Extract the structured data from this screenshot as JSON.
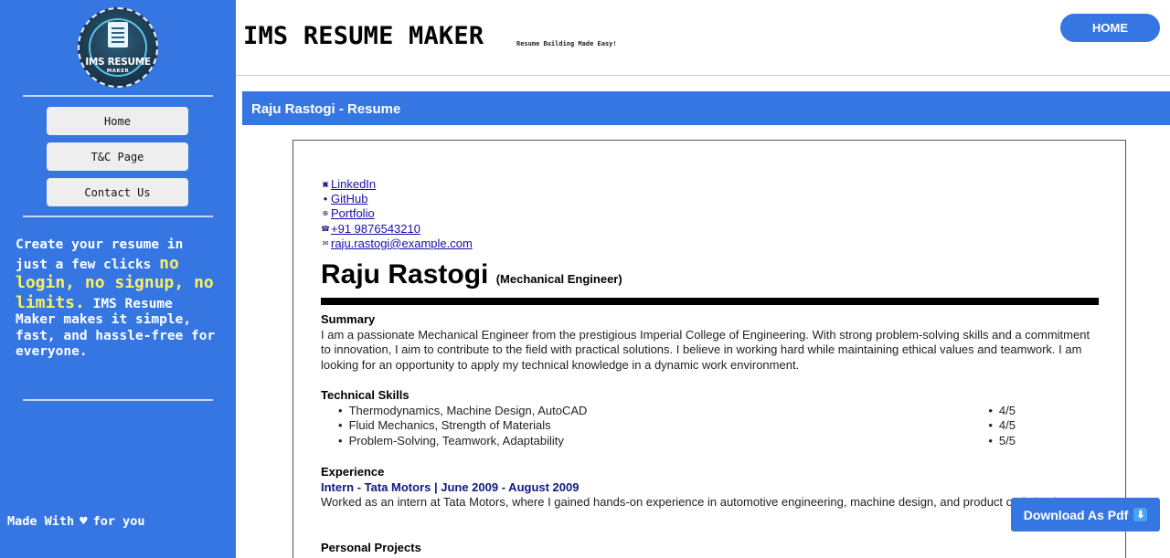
{
  "sidebar": {
    "logo": {
      "line1": "IMS RESUME",
      "line2": "MAKER"
    },
    "nav": [
      {
        "label": "Home"
      },
      {
        "label": "T&C Page"
      },
      {
        "label": "Contact Us"
      }
    ],
    "tagline": {
      "part1": "Create your resume in just a few clicks ",
      "highlight": "no login, no signup, no limits.",
      "part2": " IMS Resume Maker makes it simple, fast, and hassle-free for everyone."
    },
    "footer": {
      "before": "Made With",
      "icon": "heart-icon",
      "after": "for you"
    }
  },
  "header": {
    "title": "IMS RESUME MAKER",
    "subtitle": "Resume Building Made Easy!",
    "home_button": "HOME"
  },
  "banner": {
    "title": "Raju Rastogi - Resume"
  },
  "resume": {
    "contacts": [
      {
        "icon": "linkedin-icon",
        "glyph": "▣",
        "label": "LinkedIn"
      },
      {
        "icon": "github-icon",
        "glyph": "●",
        "label": "GitHub"
      },
      {
        "icon": "globe-icon",
        "glyph": "⊕",
        "label": "Portfolio"
      },
      {
        "icon": "phone-icon",
        "glyph": "☎",
        "label": "+91 9876543210"
      },
      {
        "icon": "mail-icon",
        "glyph": "✉",
        "label": "raju.rastogi@example.com"
      }
    ],
    "name": "Raju Rastogi",
    "role": "(Mechanical Engineer)",
    "summary_title": "Summary",
    "summary": "I am a passionate Mechanical Engineer from the prestigious Imperial College of Engineering. With strong problem-solving skills and a commitment to innovation, I aim to contribute to the field with practical solutions. I believe in working hard while maintaining ethical values and teamwork. I am looking for an opportunity to apply my technical knowledge in a dynamic work environment.",
    "skills_title": "Technical Skills",
    "skills": [
      {
        "name": "Thermodynamics, Machine Design, AutoCAD",
        "rating": "4/5"
      },
      {
        "name": "Fluid Mechanics, Strength of Materials",
        "rating": "4/5"
      },
      {
        "name": "Problem-Solving, Teamwork, Adaptability",
        "rating": "5/5"
      }
    ],
    "experience_title": "Experience",
    "experience_role": "Intern - Tata Motors | June 2009 - August 2009",
    "experience_desc": "Worked as an intern at Tata Motors, where I gained hands-on experience in automotive engineering, machine design, and product optimization.",
    "projects_title": "Personal Projects"
  },
  "download_button": {
    "label": "Download As Pdf",
    "icon": "download-icon",
    "glyph": "⬇"
  },
  "colors": {
    "accent": "#3676e3",
    "highlight": "#f8f060",
    "exp_heading": "#0f1a80"
  }
}
